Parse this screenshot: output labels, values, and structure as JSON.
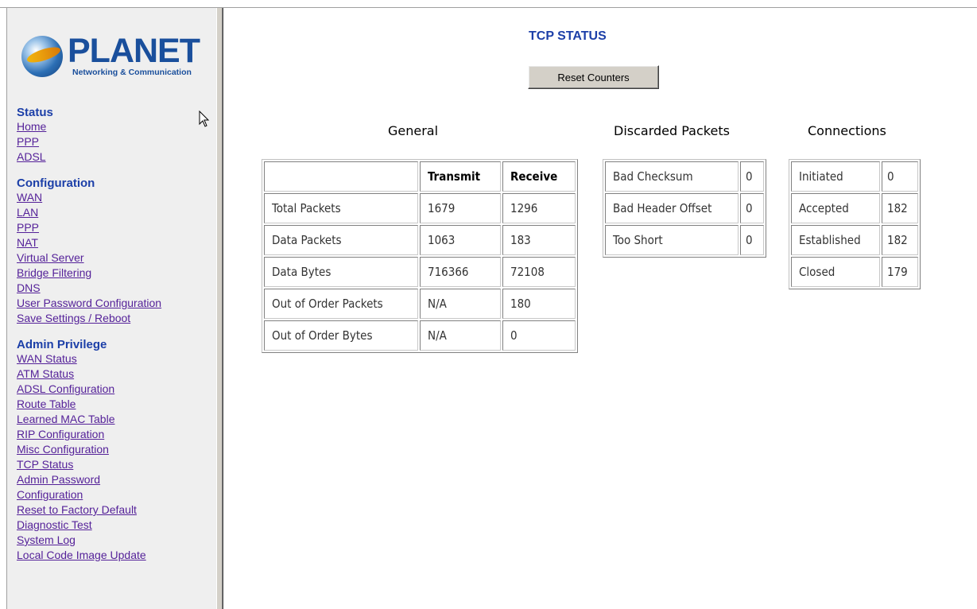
{
  "logo": {
    "name": "PLANET",
    "tagline": "Networking & Communication"
  },
  "sidebar": {
    "sections": [
      {
        "heading": "Status",
        "links": [
          "Home",
          "PPP",
          "ADSL"
        ]
      },
      {
        "heading": "Configuration",
        "links": [
          "WAN",
          "LAN",
          "PPP",
          "NAT",
          "Virtual Server",
          "Bridge Filtering",
          "DNS",
          "User Password Configuration",
          "Save Settings / Reboot"
        ]
      },
      {
        "heading": "Admin Privilege",
        "links": [
          "WAN Status",
          "ATM Status",
          "ADSL Configuration",
          "Route Table",
          "Learned MAC Table",
          "RIP Configuration",
          "Misc Configuration",
          "TCP Status",
          "Admin Password",
          "Configuration",
          "Reset to Factory Default",
          "Diagnostic Test",
          "System Log",
          "Local Code Image Update"
        ]
      }
    ]
  },
  "main": {
    "title": "TCP STATUS",
    "reset_button": "Reset Counters",
    "general": {
      "title": "General",
      "columns": [
        "",
        "Transmit",
        "Receive"
      ],
      "rows": [
        [
          "Total Packets",
          "1679",
          "1296"
        ],
        [
          "Data Packets",
          "1063",
          "183"
        ],
        [
          "Data Bytes",
          "716366",
          "72108"
        ],
        [
          "Out of Order Packets",
          "N/A",
          "180"
        ],
        [
          "Out of Order Bytes",
          "N/A",
          "0"
        ]
      ]
    },
    "discarded": {
      "title": "Discarded Packets",
      "rows": [
        [
          "Bad Checksum",
          "0"
        ],
        [
          "Bad Header Offset",
          "0"
        ],
        [
          "Too Short",
          "0"
        ]
      ]
    },
    "connections": {
      "title": "Connections",
      "rows": [
        [
          "Initiated",
          "0"
        ],
        [
          "Accepted",
          "182"
        ],
        [
          "Established",
          "182"
        ],
        [
          "Closed",
          "179"
        ]
      ]
    }
  },
  "colors": {
    "heading": "#1c3fa8",
    "link": "#552299",
    "sidebar_bg": "#efefef",
    "button_bg": "#d4d0c8"
  }
}
